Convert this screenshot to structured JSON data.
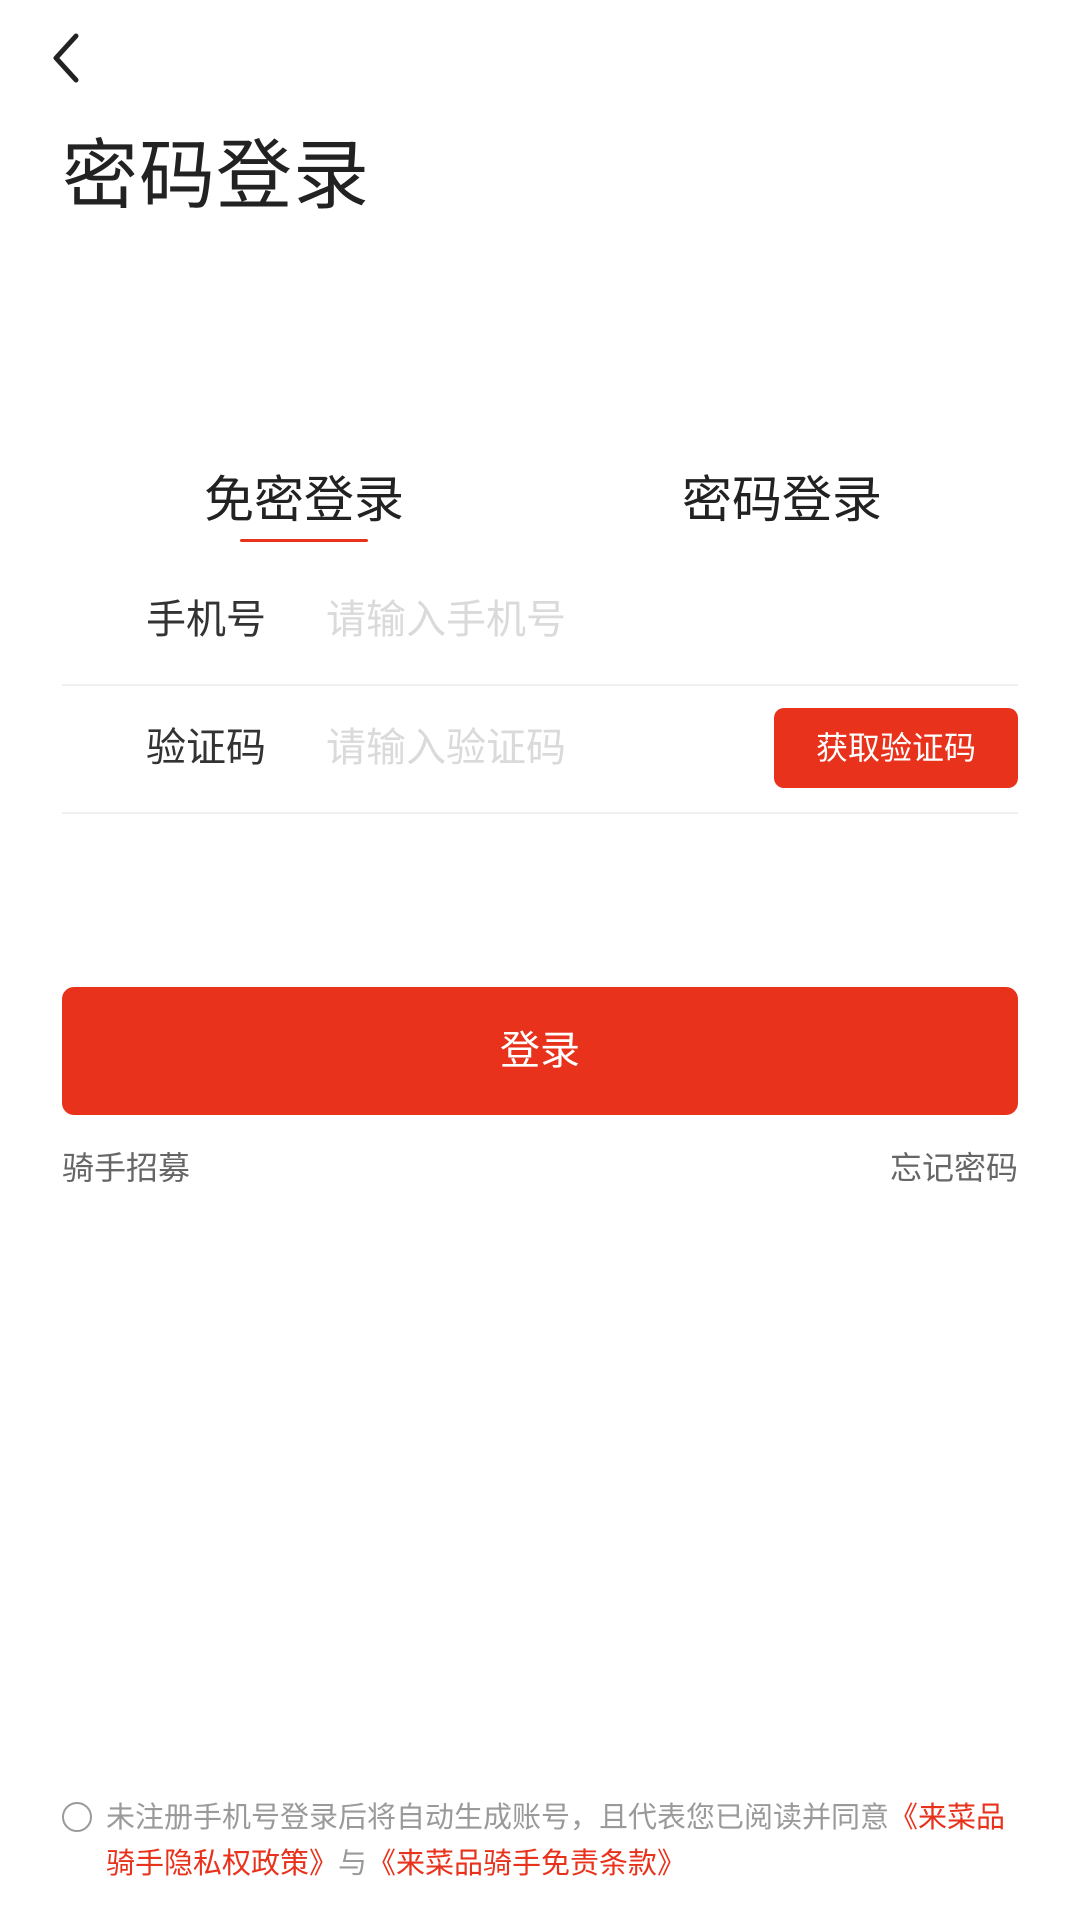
{
  "header": {
    "back_icon": "chevron-left-icon",
    "title": "密码登录"
  },
  "tabs": [
    {
      "label": "免密登录",
      "active": true
    },
    {
      "label": "密码登录",
      "active": false
    }
  ],
  "form": {
    "phone": {
      "label": "手机号",
      "placeholder": "请输入手机号",
      "value": ""
    },
    "code": {
      "label": "验证码",
      "placeholder": "请输入验证码",
      "value": "",
      "get_code_label": "获取验证码"
    }
  },
  "login_label": "登录",
  "links": {
    "recruit": "骑手招募",
    "forgot_password": "忘记密码"
  },
  "agreement": {
    "checked": false,
    "text_before": "未注册手机号登录后将自动生成账号，且代表您已阅读并同意",
    "privacy_link": "《来菜品骑手隐私权政策》",
    "joiner": "与",
    "terms_link": "《来菜品骑手免责条款》"
  },
  "colors": {
    "accent": "#e8321c",
    "text": "#333333",
    "placeholder": "#dadada",
    "muted": "#9a9a9a"
  }
}
